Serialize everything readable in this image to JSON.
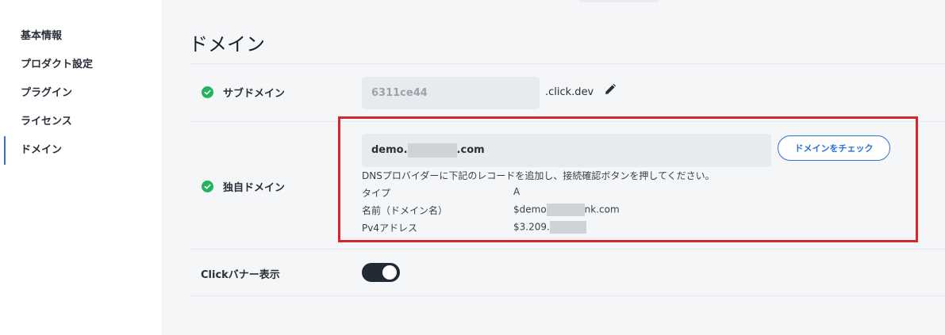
{
  "sidebar": {
    "items": [
      {
        "label": "基本情報"
      },
      {
        "label": "プロダクト設定"
      },
      {
        "label": "プラグイン"
      },
      {
        "label": "ライセンス"
      },
      {
        "label": "ドメイン"
      }
    ],
    "active_index": 4
  },
  "page": {
    "title": "ドメイン"
  },
  "subdomain": {
    "label": "サブドメイン",
    "value": "6311ce44",
    "suffix": ".click.dev",
    "status": "verified"
  },
  "custom_domain": {
    "label": "独自ドメイン",
    "value_prefix": "demo.",
    "value_suffix": ".com",
    "check_button": "ドメインをチェック",
    "instructions": "DNSプロバイダーに下記のレコードを追加し、接続確認ボタンを押してください。",
    "records": [
      {
        "key": "タイプ",
        "value_prefix": "A",
        "value_suffix": ""
      },
      {
        "key": "名前（ドメイン名）",
        "value_prefix": "$demo",
        "value_suffix": "nk.com"
      },
      {
        "key": "Pv4アドレス",
        "value_prefix": "$3.209.",
        "value_suffix": ""
      }
    ],
    "status": "verified"
  },
  "banner": {
    "label": "Clickバナー表示",
    "enabled": true
  },
  "colors": {
    "accent": "#2f6fd6",
    "success": "#22b35e",
    "highlight": "#d7252a",
    "toggle_on": "#222a36"
  }
}
